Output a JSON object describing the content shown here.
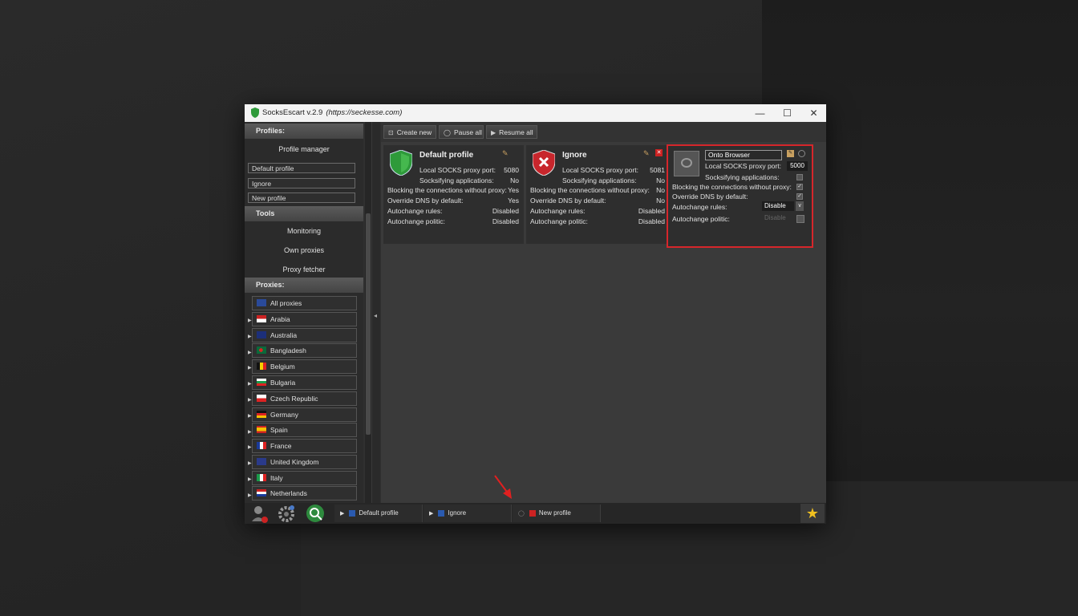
{
  "window": {
    "title": "SocksEscart v.2.9",
    "url": "(https://seckesse.com)",
    "controls": {
      "minimize": "—",
      "maximize": "☐",
      "close": "✕"
    }
  },
  "sidebar": {
    "profiles_header": "Profiles:",
    "profile_manager": "Profile manager",
    "profile_items": [
      "Default profile",
      "Ignore",
      "New profile"
    ],
    "tools_header": "Tools",
    "tools": [
      "Monitoring",
      "Own proxies",
      "Proxy fetcher"
    ],
    "proxies_header": "Proxies:",
    "countries": [
      {
        "name": "All proxies",
        "icon": "globe-flag"
      },
      {
        "name": "Arabia",
        "icon": "flag-red-white"
      },
      {
        "name": "Australia",
        "icon": "flag-australia"
      },
      {
        "name": "Bangladesh",
        "icon": "flag-bangladesh"
      },
      {
        "name": "Belgium",
        "icon": "flag-belgium"
      },
      {
        "name": "Bulgaria",
        "icon": "flag-bulgaria"
      },
      {
        "name": "Czech Republic",
        "icon": "flag-czech"
      },
      {
        "name": "Germany",
        "icon": "flag-germany"
      },
      {
        "name": "Spain",
        "icon": "flag-spain"
      },
      {
        "name": "France",
        "icon": "flag-france"
      },
      {
        "name": "United Kingdom",
        "icon": "flag-uk"
      },
      {
        "name": "Italy",
        "icon": "flag-italy"
      },
      {
        "name": "Netherlands",
        "icon": "flag-netherlands"
      }
    ]
  },
  "toolbar": {
    "create_new": "Create new",
    "pause_all": "Pause all",
    "resume_all": "Resume all"
  },
  "cards": [
    {
      "name": "Default profile",
      "rows": [
        {
          "label": "Local SOCKS proxy port:",
          "value": "5080"
        },
        {
          "label": "Socksifying applications:",
          "value": "No"
        },
        {
          "label": "Blocking the connections without proxy:",
          "value": "Yes"
        },
        {
          "label": "Override DNS by default:",
          "value": "Yes"
        },
        {
          "label": "Autochange rules:",
          "value": "Disabled"
        },
        {
          "label": "Autochange politic:",
          "value": "Disabled"
        }
      ]
    },
    {
      "name": "Ignore",
      "rows": [
        {
          "label": "Local SOCKS proxy port:",
          "value": "5081"
        },
        {
          "label": "Socksifying applications:",
          "value": "No"
        },
        {
          "label": "Blocking the connections without proxy:",
          "value": "No"
        },
        {
          "label": "Override DNS by default:",
          "value": "No"
        },
        {
          "label": "Autochange rules:",
          "value": "Disabled"
        },
        {
          "label": "Autochange politic:",
          "value": "Disabled"
        }
      ]
    }
  ],
  "edit_card": {
    "name_value": "Onto Browser",
    "port_label": "Local SOCKS proxy port:",
    "port_value": "5000",
    "socksify_label": "Socksifying applications:",
    "blocking_label": "Blocking the connections without proxy:",
    "dns_label": "Override DNS by default:",
    "rules_label": "Autochange rules:",
    "rules_value": "Disable",
    "politic_label": "Autochange politic:",
    "politic_value": "Disable",
    "check_mark": "✓",
    "dropdown_arrow": "∨"
  },
  "bottom_tabs": [
    {
      "label": "Default profile",
      "state": "play"
    },
    {
      "label": "Ignore",
      "state": "play"
    },
    {
      "label": "New profile",
      "state": "stopped"
    }
  ],
  "icons": {
    "splitter": "◂",
    "play": "▶",
    "star": "★",
    "toolbar_create": "⊡",
    "toolbar_pause": "◯",
    "toolbar_resume": "▶",
    "expand": "▶",
    "edit": "✎",
    "delete": "✕"
  },
  "colors": {
    "accent_red": "#d6262b",
    "shield_green": "#2e9a3a",
    "shield_red": "#c8262c",
    "star": "#f0c020"
  }
}
